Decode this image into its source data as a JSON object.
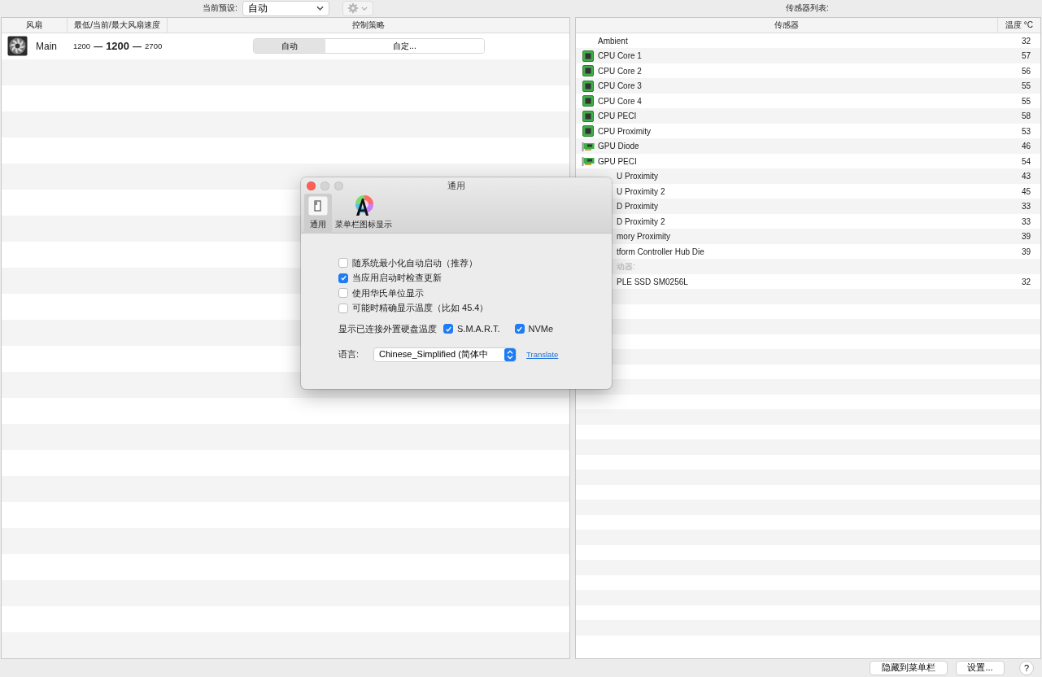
{
  "toolbar": {
    "preset_label": "当前预设:",
    "preset_value": "自动"
  },
  "sensor_list_title": "传感器列表:",
  "fans": {
    "columns": [
      "风扇",
      "最低/当前/最大风扇速度",
      "控制策略"
    ],
    "rows": [
      {
        "name": "Main",
        "min": "1200",
        "separators": [
          "—",
          "—"
        ],
        "current": "1200",
        "max": "2700",
        "modes": [
          {
            "label": "自动",
            "selected": true
          },
          {
            "label": "自定...",
            "selected": false
          }
        ]
      }
    ]
  },
  "sensors": {
    "columns": [
      "传感器",
      "温度 °C"
    ],
    "rows": [
      {
        "kind": "plain",
        "name": "Ambient",
        "value": "32"
      },
      {
        "kind": "cpu",
        "name": "CPU Core 1",
        "value": "57"
      },
      {
        "kind": "cpu",
        "name": "CPU Core 2",
        "value": "56"
      },
      {
        "kind": "cpu",
        "name": "CPU Core 3",
        "value": "55"
      },
      {
        "kind": "cpu",
        "name": "CPU Core 4",
        "value": "55"
      },
      {
        "kind": "cpu",
        "name": "CPU PECI",
        "value": "58"
      },
      {
        "kind": "cpu",
        "name": "CPU Proximity",
        "value": "53"
      },
      {
        "kind": "gpu",
        "name": "GPU Diode",
        "value": "46"
      },
      {
        "kind": "gpu",
        "name": "GPU PECI",
        "value": "54"
      },
      {
        "kind": "cut",
        "name": "U Proximity",
        "value": "43"
      },
      {
        "kind": "cut",
        "name": "U Proximity 2",
        "value": "45"
      },
      {
        "kind": "cut",
        "name": "D Proximity",
        "value": "33"
      },
      {
        "kind": "cut",
        "name": "D Proximity 2",
        "value": "33"
      },
      {
        "kind": "cut",
        "name": "mory Proximity",
        "value": "39"
      },
      {
        "kind": "cut",
        "name": "tform Controller Hub Die",
        "value": "39"
      },
      {
        "kind": "group",
        "name": "动器:"
      },
      {
        "kind": "cut",
        "name": "PLE SSD SM0256L",
        "value": "32"
      }
    ]
  },
  "dialog": {
    "title": "通用",
    "tabs": [
      {
        "label": "通用",
        "selected": true
      },
      {
        "label": "菜单栏图标显示",
        "selected": false
      }
    ],
    "options": [
      {
        "label": "随系统最小化自动启动（推荐）",
        "checked": false
      },
      {
        "label": "当应用启动时检查更新",
        "checked": true
      },
      {
        "label": "使用华氏单位显示",
        "checked": false
      },
      {
        "label": "可能时精确显示温度（比如 45.4）",
        "checked": false
      }
    ],
    "external": {
      "label": "显示已连接外置硬盘温度",
      "options": [
        {
          "label": "S.M.A.R.T.",
          "checked": true
        },
        {
          "label": "NVMe",
          "checked": true
        }
      ]
    },
    "language": {
      "label": "语言:",
      "value": "Chinese_Simplified (简体中",
      "link": "Translate"
    }
  },
  "footer": {
    "buttons": [
      "隐藏到菜单栏",
      "设置..."
    ],
    "help": "?"
  }
}
